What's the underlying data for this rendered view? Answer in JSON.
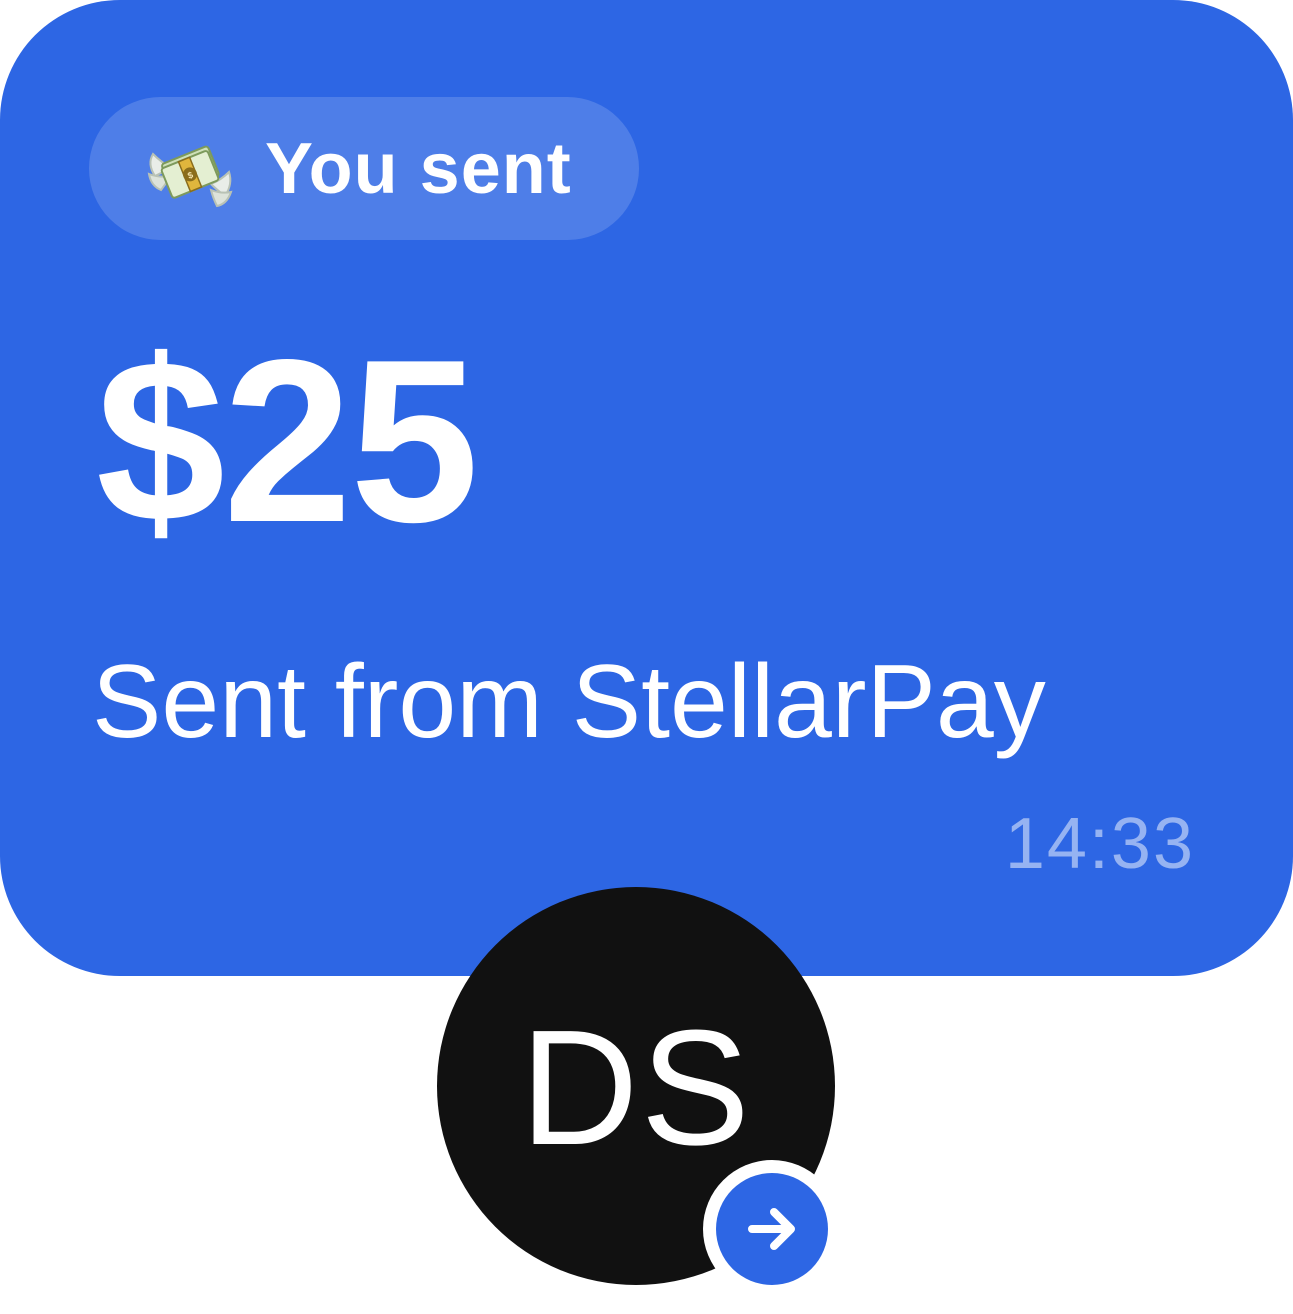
{
  "message": {
    "tag_icon": "money-with-wings-icon",
    "tag_label": "You sent",
    "amount": "$25",
    "note": "Sent from StellarPay",
    "time": "14:33"
  },
  "sender": {
    "initials": "DS",
    "badge_icon": "arrow-right-icon"
  },
  "colors": {
    "bubble": "#2d66e4",
    "avatar": "#111111",
    "text": "#ffffff"
  }
}
